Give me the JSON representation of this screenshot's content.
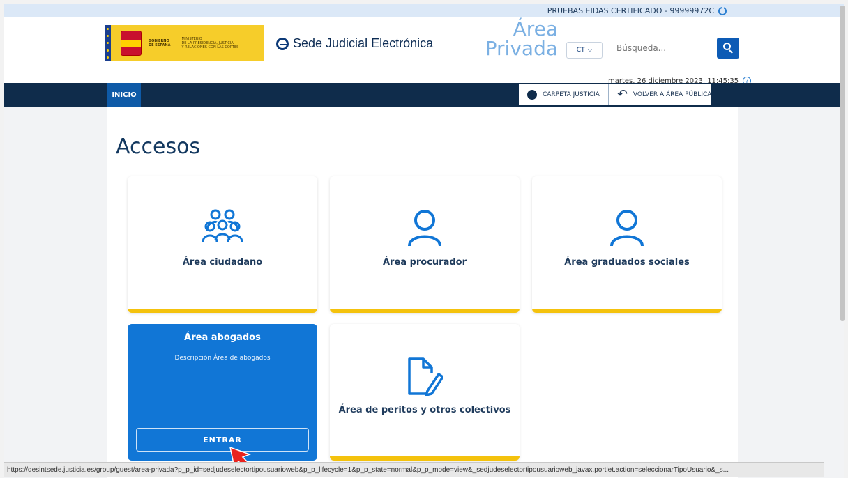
{
  "topbar": {
    "user": "PRUEBAS EIDAS CERTIFICADO - 99999972C"
  },
  "header": {
    "gov_line1": "GOBIERNO",
    "gov_line2": "DE ESPAÑA",
    "ministry_line1": "MINISTERIO",
    "ministry_line2": "DE LA PRESIDENCIA, JUSTICIA",
    "ministry_line3": "Y RELACIONES CON LAS CORTES",
    "site_name": "Sede Judicial Electrónica",
    "area_line1": "Área",
    "area_line2": "Privada",
    "lang": "CT",
    "search_placeholder": "Búsqueda...",
    "datetime": "martes, 26 diciembre 2023, 11:45:35",
    "help": "?"
  },
  "nav": {
    "home": "INICIO",
    "carpeta": "CARPETA JUSTICIA",
    "volver": "VOLVER A ÁREA PÚBLICA"
  },
  "main": {
    "title": "Accesos",
    "cards": [
      {
        "label": "Área ciudadano",
        "icon": "group-users-icon"
      },
      {
        "label": "Área procurador",
        "icon": "user-icon"
      },
      {
        "label": "Área graduados sociales",
        "icon": "user-icon"
      },
      {
        "label": "Área abogados",
        "description": "Descripción Área de abogados",
        "button": "ENTRAR",
        "active": true
      },
      {
        "label": "Área de peritos y otros colectivos",
        "icon": "document-edit-icon"
      }
    ]
  },
  "statusbar": {
    "url": "https://desintsede.justicia.es/group/guest/area-privada?p_p_id=sedjudeselectortipousuarioweb&p_p_lifecycle=1&p_p_state=normal&p_p_mode=view&_sedjudeselectortipousuarioweb_javax.portlet.action=seleccionarTipoUsuario&_s..."
  },
  "colors": {
    "accent": "#1176d6",
    "navbar": "#0f2c4b",
    "card_bar": "#f4c20d"
  }
}
